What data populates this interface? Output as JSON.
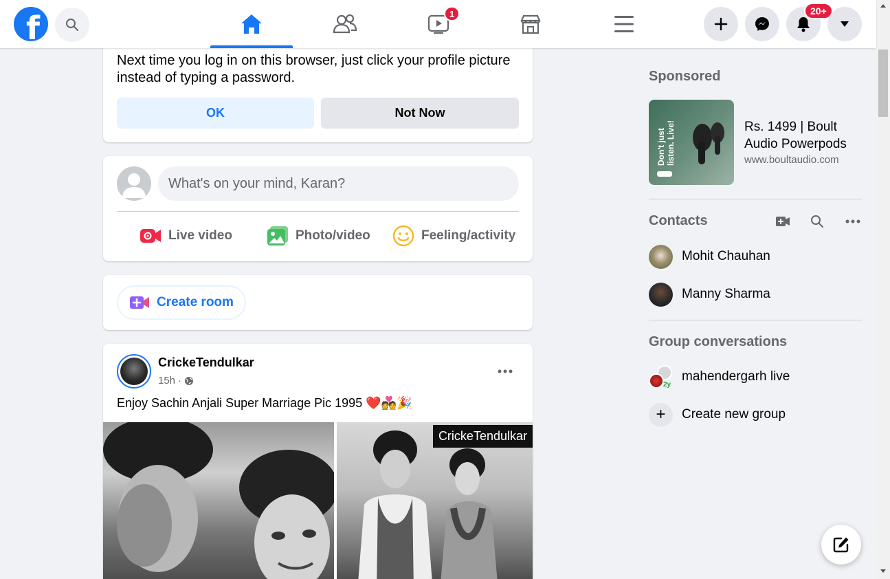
{
  "topbar": {
    "logo_letter": "f",
    "tabs": [
      {
        "name": "home",
        "active": true
      },
      {
        "name": "friends",
        "active": false
      },
      {
        "name": "watch",
        "active": false,
        "badge": "1"
      },
      {
        "name": "marketplace",
        "active": false
      },
      {
        "name": "menu",
        "active": false
      }
    ],
    "notifications_badge": "20+"
  },
  "save_login": {
    "message": "Next time you log in on this browser, just click your profile picture instead of typing a password.",
    "ok_label": "OK",
    "not_now_label": "Not Now"
  },
  "composer": {
    "placeholder": "What's on your mind, Karan?",
    "actions": [
      {
        "label": "Live video",
        "icon": "live-video-icon",
        "color": "#f02849"
      },
      {
        "label": "Photo/video",
        "icon": "photo-video-icon",
        "color": "#45bd62"
      },
      {
        "label": "Feeling/activity",
        "icon": "feeling-icon",
        "color": "#f7b928"
      }
    ]
  },
  "room": {
    "create_room_label": "Create room"
  },
  "post": {
    "author": "CrickeTendulkar",
    "time": "15h",
    "separator": "·",
    "text": "Enjoy Sachin Anjali Super Marriage Pic 1995 ❤️💑🎉",
    "image_watermark": "CrickeTendulkar"
  },
  "sidebar": {
    "sponsored_heading": "Sponsored",
    "ad": {
      "title": "Rs. 1499 | Boult Audio Powerpods",
      "url": "www.boultaudio.com",
      "image_text": "Don't just listen. Live!"
    },
    "contacts_heading": "Contacts",
    "contacts": [
      {
        "name": "Mohit Chauhan"
      },
      {
        "name": "Manny Sharma"
      }
    ],
    "groups_heading": "Group conversations",
    "groups": [
      {
        "name": "mahendergarh live",
        "badge": "2y"
      }
    ],
    "create_group_label": "Create new group"
  },
  "colors": {
    "brand_blue": "#1877f2",
    "badge_red": "#e41e3f",
    "background": "#f0f2f5"
  }
}
